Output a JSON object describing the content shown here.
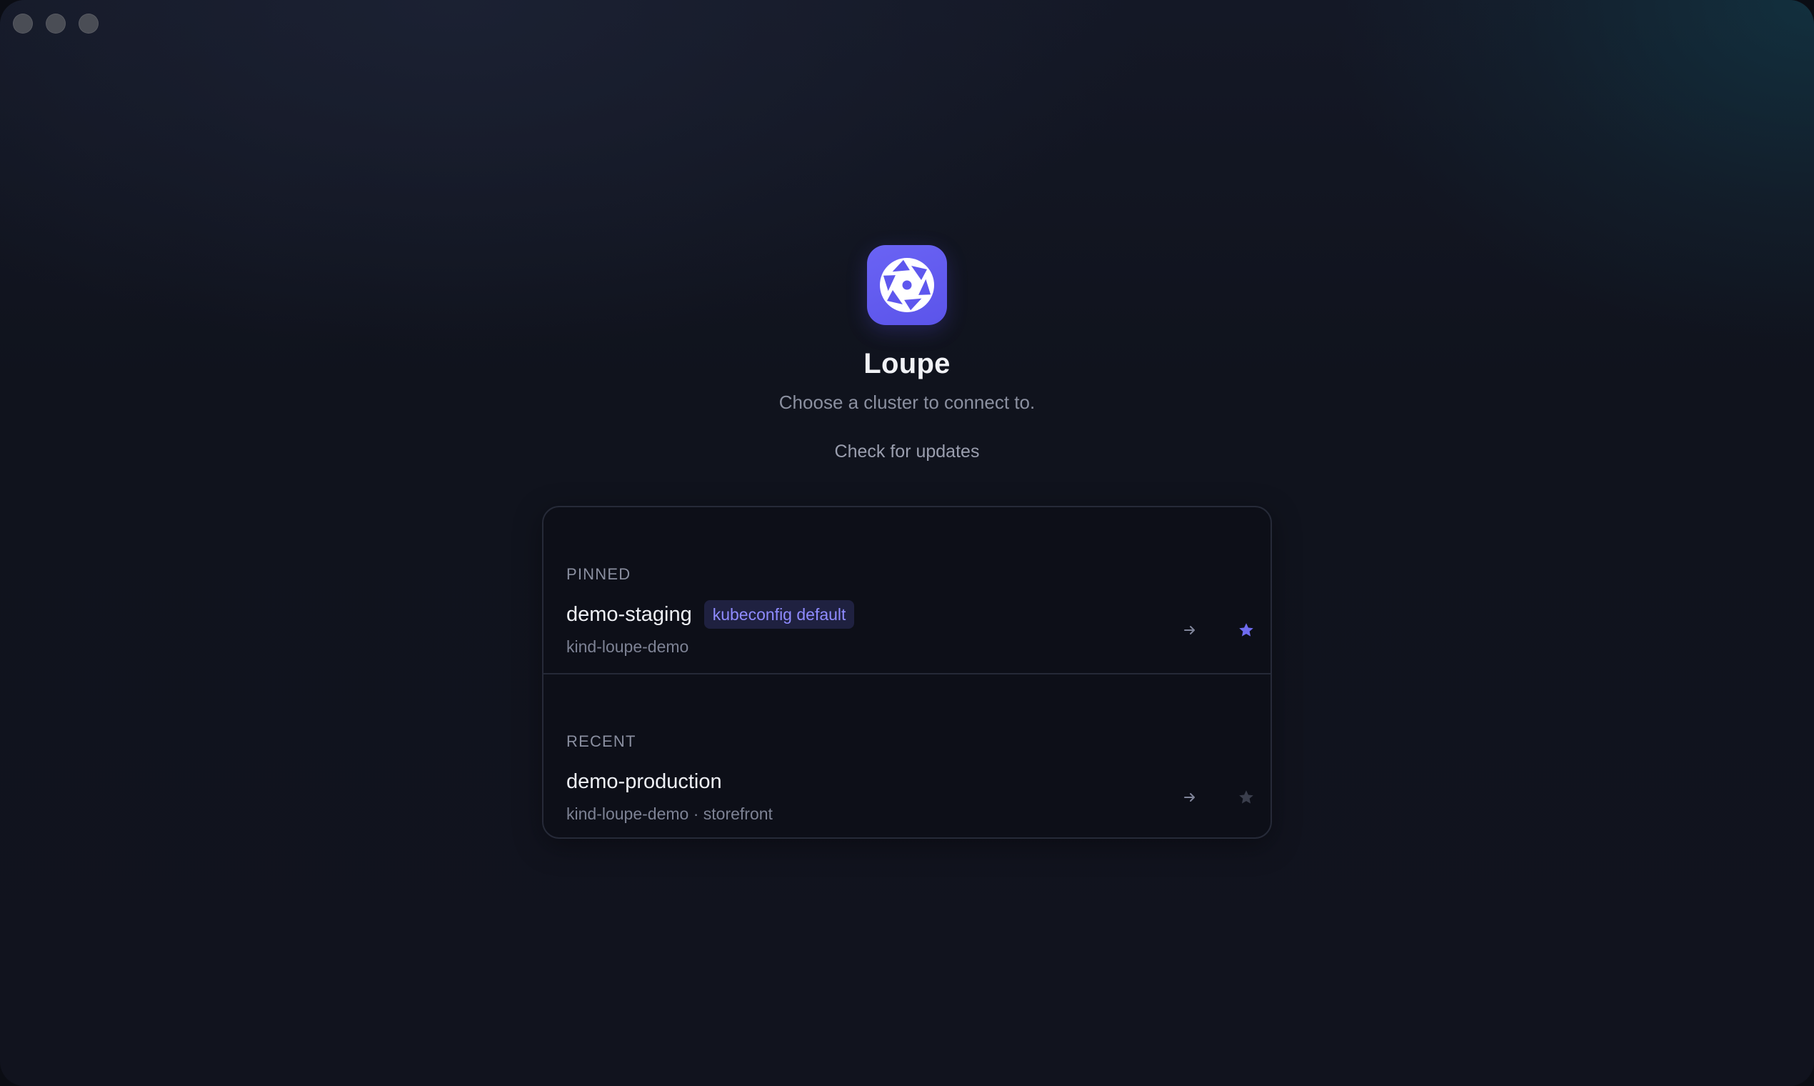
{
  "app": {
    "title": "Loupe",
    "subtitle": "Choose a cluster to connect to.",
    "update_link": "Check for updates",
    "icon": "aperture-icon",
    "accent_color": "#6a63f4"
  },
  "window": {
    "controls": [
      "close-control",
      "minimize-control",
      "zoom-control"
    ]
  },
  "clusters": {
    "pinned": {
      "label": "PINNED",
      "items": [
        {
          "name": "demo-staging",
          "badge": "kubeconfig default",
          "context": "kind-loupe-demo",
          "pinned": true,
          "star_color": "#6f6cf0"
        }
      ]
    },
    "recent": {
      "label": "RECENT",
      "items": [
        {
          "name": "demo-production",
          "badge": "",
          "context": "kind-loupe-demo · storefront",
          "pinned": false,
          "star_color": "#3a3e4c"
        }
      ]
    }
  }
}
